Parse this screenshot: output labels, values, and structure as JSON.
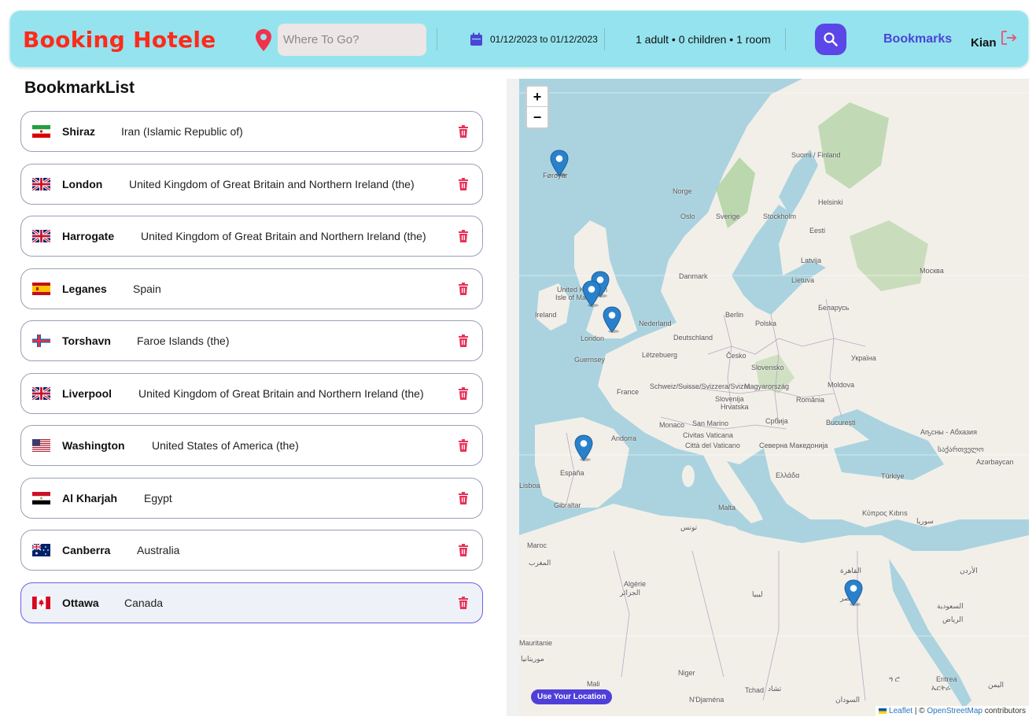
{
  "header": {
    "brand": "Booking Hotele",
    "search_placeholder": "Where To Go?",
    "dates": "01/12/2023 to 01/12/2023",
    "guests": "1 adult • 0 children • 1 room",
    "bookmarks_label": "Bookmarks",
    "user_name": "Kian"
  },
  "list_title": "BookmarkList",
  "bookmarks": [
    {
      "city": "Shiraz",
      "country": "Iran (Islamic Republic of)",
      "flag": "ir-flag"
    },
    {
      "city": "London",
      "country": "United Kingdom of Great Britain and Northern Ireland (the)",
      "flag": "gb-flag"
    },
    {
      "city": "Harrogate",
      "country": "United Kingdom of Great Britain and Northern Ireland (the)",
      "flag": "gb-flag"
    },
    {
      "city": "Leganes",
      "country": "Spain",
      "flag": "es-flag"
    },
    {
      "city": "Torshavn",
      "country": "Faroe Islands (the)",
      "flag": "fo-flag"
    },
    {
      "city": "Liverpool",
      "country": "United Kingdom of Great Britain and Northern Ireland (the)",
      "flag": "gb-flag"
    },
    {
      "city": "Washington",
      "country": "United States of America (the)",
      "flag": "us-flag"
    },
    {
      "city": "Al Kharjah",
      "country": "Egypt",
      "flag": "eg-flag"
    },
    {
      "city": "Canberra",
      "country": "Australia",
      "flag": "au-flag"
    },
    {
      "city": "Ottawa",
      "country": "Canada",
      "flag": "ca-flag",
      "active": true
    }
  ],
  "map": {
    "zoom_in": "+",
    "zoom_out": "−",
    "use_location": "Use Your Location",
    "attribution_leaflet": "Leaflet",
    "attribution_sep": "| ©",
    "attribution_osm": "OpenStreetMap",
    "attribution_tail": "contributors",
    "labels": [
      "Føroyar",
      "Norge",
      "Suomi / Finland",
      "Oslo",
      "Sverige",
      "Stockholm",
      "Helsinki",
      "Eesti",
      "Latvija",
      "Lietuva",
      "Danmark",
      "Москва",
      "United Kingdom",
      "Isle of Man",
      "Ireland",
      "London",
      "Nederland",
      "Berlin",
      "Polska",
      "Беларусь",
      "Deutschland",
      "Guernsey",
      "Lëtzebuerg",
      "Česko",
      "Україна",
      "France",
      "Schweiz/Suisse/Svizzera/Svizra",
      "Slovensko",
      "Magyarország",
      "Moldova",
      "Slovenija",
      "Hrvatska",
      "România",
      "Monaco",
      "San Marino",
      "Србија",
      "București",
      "Andorra",
      "Civitas Vaticana",
      "Città del Vaticano",
      "Северна Македонија",
      "Аҧсны - Абхазия",
      "საქართველო",
      "Azərbaycan",
      "España",
      "Ελλάδα",
      "Türkiye",
      "Lisboa",
      "Gibraltar",
      "Malta",
      "Κύπρος Kıbrıs",
      "سوريا",
      "تونس",
      "Maroc",
      "المغرب",
      "ليبيا",
      "القاهرة",
      "الأردن",
      "Algérie",
      "الجزائر",
      "مصر",
      "السعودية",
      "الرياض",
      "Mauritanie",
      "موريتانيا",
      "Niger",
      "Mali",
      "Tchad",
      "تشاد",
      "N'Djaména",
      "السودان",
      "Eritrea",
      "ኤርትራ",
      "ዓ ሮ",
      "اليمن"
    ]
  }
}
